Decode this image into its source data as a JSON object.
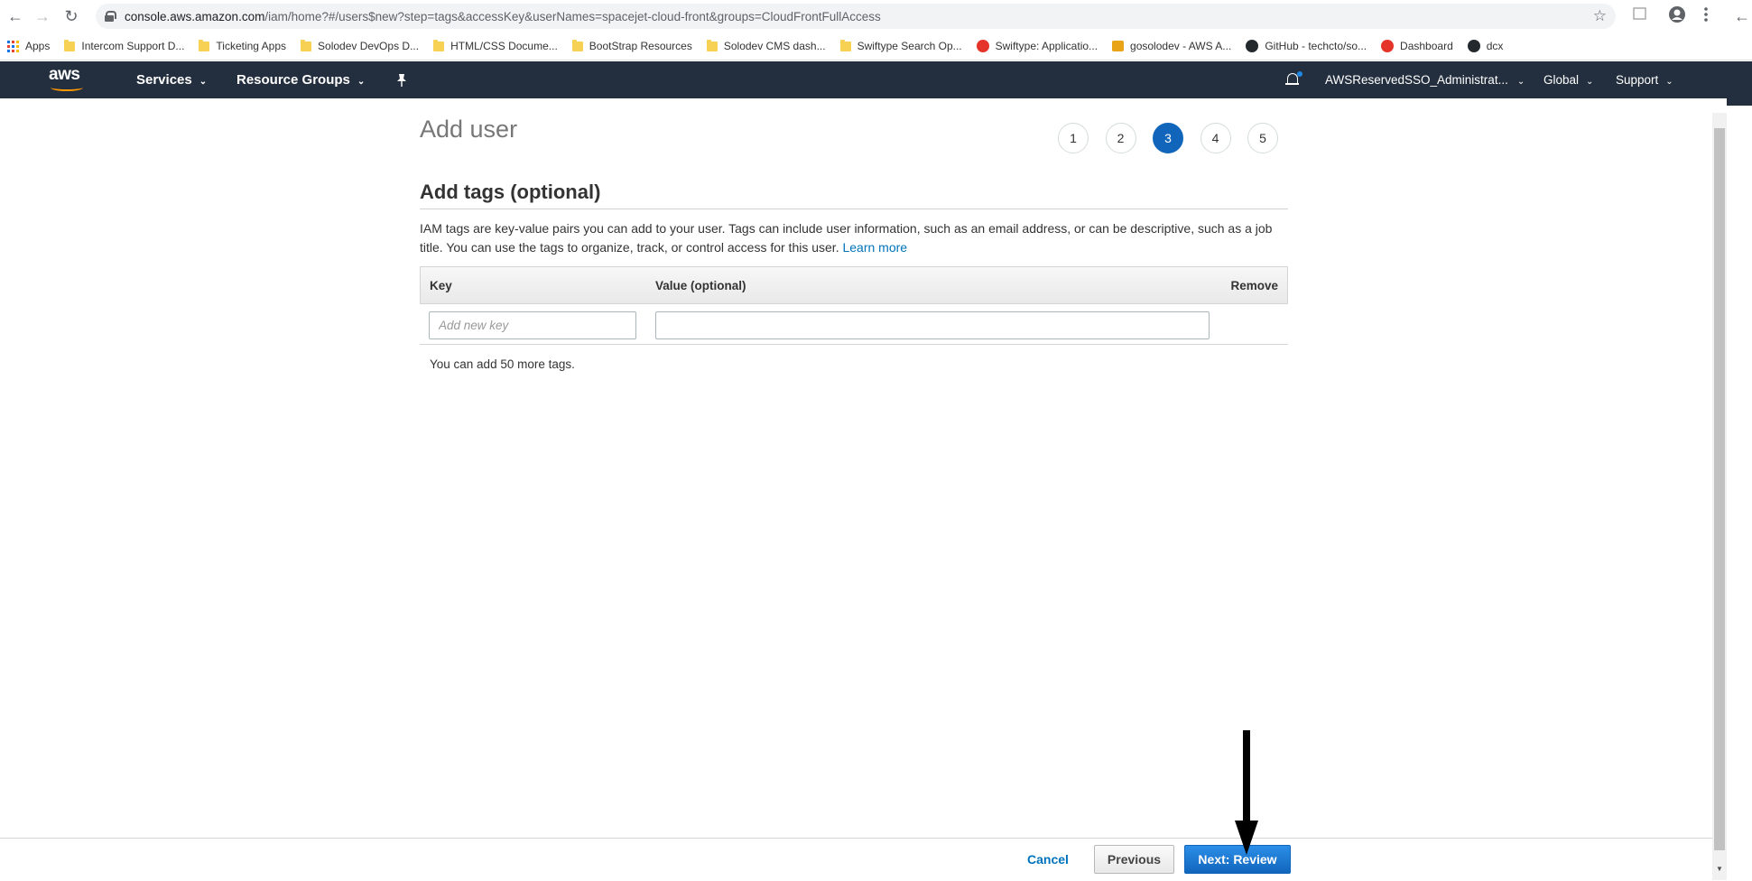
{
  "browser": {
    "url_host": "console.aws.amazon.com",
    "url_path": "/iam/home?#/users$new?step=tags&accessKey&userNames=spacejet-cloud-front&groups=CloudFrontFullAccess"
  },
  "bookmarks": [
    {
      "label": "Apps",
      "icon": "apps-grid-icon"
    },
    {
      "label": "Intercom Support D...",
      "icon": "folder-icon"
    },
    {
      "label": "Ticketing Apps",
      "icon": "folder-icon"
    },
    {
      "label": "Solodev DevOps D...",
      "icon": "folder-icon"
    },
    {
      "label": "HTML/CSS Docume...",
      "icon": "folder-icon"
    },
    {
      "label": "BootStrap Resources",
      "icon": "folder-icon"
    },
    {
      "label": "Solodev CMS dash...",
      "icon": "folder-icon"
    },
    {
      "label": "Swiftype Search Op...",
      "icon": "folder-icon"
    },
    {
      "label": "Swiftype: Applicatio...",
      "icon": "swiftype-icon"
    },
    {
      "label": "gosolodev - AWS A...",
      "icon": "aws-box-icon"
    },
    {
      "label": "GitHub - techcto/so...",
      "icon": "github-icon"
    },
    {
      "label": "Dashboard",
      "icon": "dashboard-icon"
    },
    {
      "label": "dcx",
      "icon": "github-icon"
    }
  ],
  "aws_nav": {
    "logo": "aws",
    "services": "Services",
    "resource_groups": "Resource Groups",
    "account": "AWSReservedSSO_Administrat...",
    "region": "Global",
    "support": "Support"
  },
  "page": {
    "title": "Add user",
    "steps": [
      "1",
      "2",
      "3",
      "4",
      "5"
    ],
    "active_step": "3",
    "section_title": "Add tags (optional)",
    "description": "IAM tags are key-value pairs you can add to your user. Tags can include user information, such as an email address, or can be descriptive, such as a job title. You can use the tags to organize, track, or control access for this user.",
    "learn_more": "Learn more"
  },
  "tags_table": {
    "headers": {
      "key": "Key",
      "value": "Value (optional)",
      "remove": "Remove"
    },
    "key_placeholder": "Add new key",
    "value_placeholder": "",
    "note": "You can add 50 more tags."
  },
  "footer": {
    "cancel": "Cancel",
    "previous": "Previous",
    "next": "Next: Review"
  },
  "colors": {
    "aws_nav_bg": "#232f3e",
    "aws_orange": "#ff9900",
    "primary_blue": "#1166bb",
    "link_blue": "#0073bb"
  }
}
